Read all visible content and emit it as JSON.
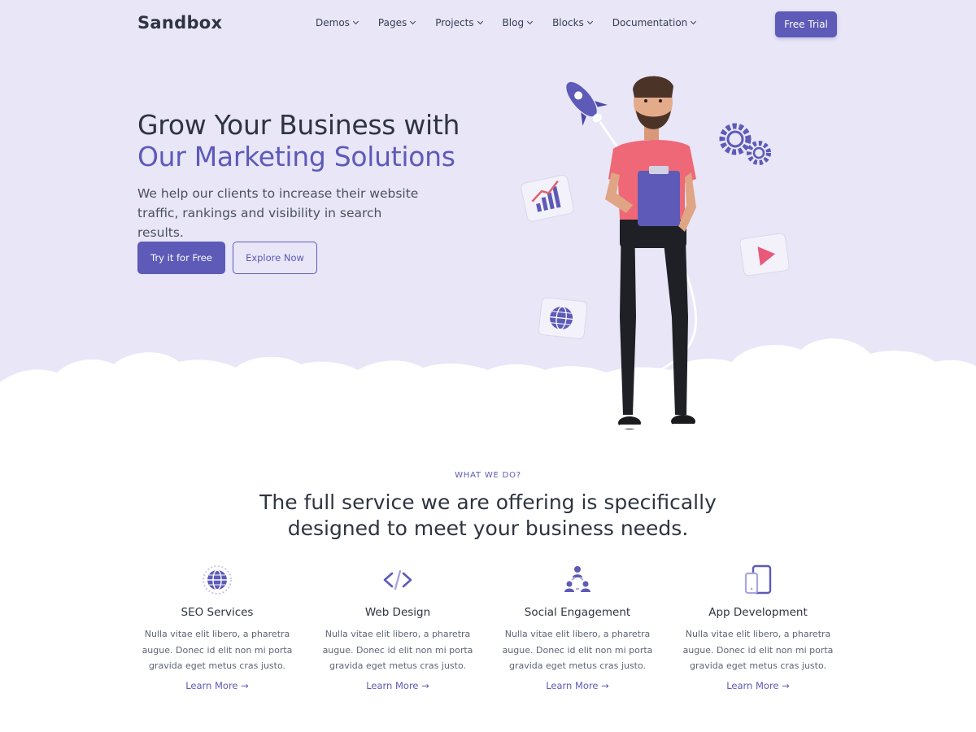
{
  "brand": {
    "logo_text": "Sandbox",
    "accent": "#5d5ab8",
    "hero_bg": "#e8e6f7"
  },
  "nav": {
    "items": [
      {
        "label": "Demos",
        "icon": "chevron-down-icon"
      },
      {
        "label": "Pages",
        "icon": "chevron-down-icon"
      },
      {
        "label": "Projects",
        "icon": "chevron-down-icon"
      },
      {
        "label": "Blog",
        "icon": "chevron-down-icon"
      },
      {
        "label": "Blocks",
        "icon": "chevron-down-icon"
      },
      {
        "label": "Documentation",
        "icon": "chevron-down-icon"
      }
    ],
    "cta_label": "Free Trial"
  },
  "hero": {
    "title_line1": "Grow Your Business with",
    "title_line2": "Our Marketing Solutions",
    "lead": "We help our clients to increase their website traffic, rankings and visibility in search results.",
    "primary_label": "Try it for Free",
    "secondary_label": "Explore Now",
    "illustration_icons": [
      "rocket-icon",
      "gears-icon",
      "chart-card-icon",
      "play-card-icon",
      "globe-card-icon",
      "man-with-clipboard-figure"
    ]
  },
  "services": {
    "eyebrow": "WHAT WE DO?",
    "title_line1": "The full service we are offering is specifically",
    "title_line2": "designed to meet your business needs.",
    "items": [
      {
        "title": "SEO Services",
        "line1": "Nulla vitae elit libero, a pharetra",
        "line2": "augue. Donec id elit non mi porta",
        "line3": "gravida eget metus cras justo.",
        "link": "Learn More →",
        "icon": "globe-icon"
      },
      {
        "title": "Web Design",
        "line1": "Nulla vitae elit libero, a pharetra",
        "line2": "augue. Donec id elit non mi porta",
        "line3": "gravida eget metus cras justo.",
        "link": "Learn More →",
        "icon": "code-icon"
      },
      {
        "title": "Social Engagement",
        "line1": "Nulla vitae elit libero, a pharetra",
        "line2": "augue. Donec id elit non mi porta",
        "line3": "gravida eget metus cras justo.",
        "link": "Learn More →",
        "icon": "users-network-icon"
      },
      {
        "title": "App Development",
        "line1": "Nulla vitae elit libero, a pharetra",
        "line2": "augue. Donec id elit non mi porta",
        "line3": "gravida eget metus cras justo.",
        "link": "Learn More →",
        "icon": "devices-icon"
      }
    ]
  }
}
